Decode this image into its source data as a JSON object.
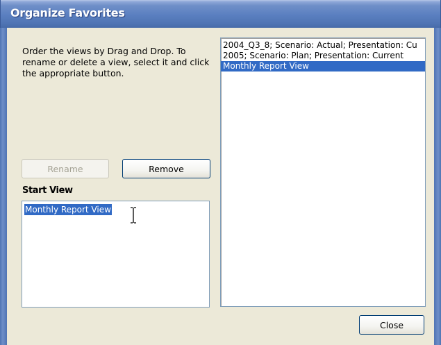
{
  "window": {
    "title": "Organize Favorites"
  },
  "instructions": {
    "text": "Order the views by Drag and Drop. To rename or delete a view, select it and click the appropriate button."
  },
  "favorites": {
    "items": [
      {
        "label": "2004_Q3_8; Scenario: Actual; Presentation: Cu",
        "selected": false
      },
      {
        "label": "2005; Scenario: Plan; Presentation: Current",
        "selected": false
      },
      {
        "label": "Monthly Report View",
        "selected": true
      }
    ]
  },
  "buttons": {
    "rename_label": "Rename",
    "remove_label": "Remove",
    "close_label": "Close"
  },
  "start_view": {
    "label": "Start View",
    "value": "Monthly Report View"
  },
  "colors": {
    "selection": "#316ac5",
    "dialog_background": "#ece9d8",
    "title_bar": "#5a7fc0"
  },
  "icons": {
    "cursor": "text-ibeam-cursor-icon"
  }
}
